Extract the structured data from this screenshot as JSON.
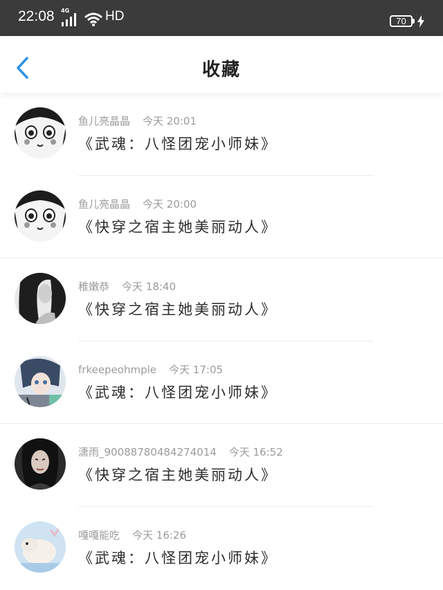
{
  "status_bar": {
    "time": "22:08",
    "network": "4G",
    "hd": "HD",
    "battery": "70"
  },
  "header": {
    "title": "收藏"
  },
  "favorites": [
    {
      "username": "鱼儿亮晶晶",
      "time": "今天 20:01",
      "title": "《武魂：八怪团宠小师妹》",
      "avatar": "manga-girl"
    },
    {
      "username": "鱼儿亮晶晶",
      "time": "今天 20:00",
      "title": "《快穿之宿主她美丽动人》",
      "avatar": "manga-girl"
    },
    {
      "username": "稚嫩恭",
      "time": "今天 18:40",
      "title": "《快穿之宿主她美丽动人》",
      "avatar": "bw-girl"
    },
    {
      "username": "frkeepeohmple",
      "time": "今天 17:05",
      "title": "《武魂：八怪团宠小师妹》",
      "avatar": "anime-girl"
    },
    {
      "username": "潇雨_900887804842740​14",
      "time": "今天 16:52",
      "title": "《快穿之宿主她美丽动人》",
      "avatar": "dark-photo"
    },
    {
      "username": "嘎嘎能吃",
      "time": "今天 16:26",
      "title": "《武魂：八怪团宠小师妹》",
      "avatar": "sheep-photo"
    }
  ]
}
